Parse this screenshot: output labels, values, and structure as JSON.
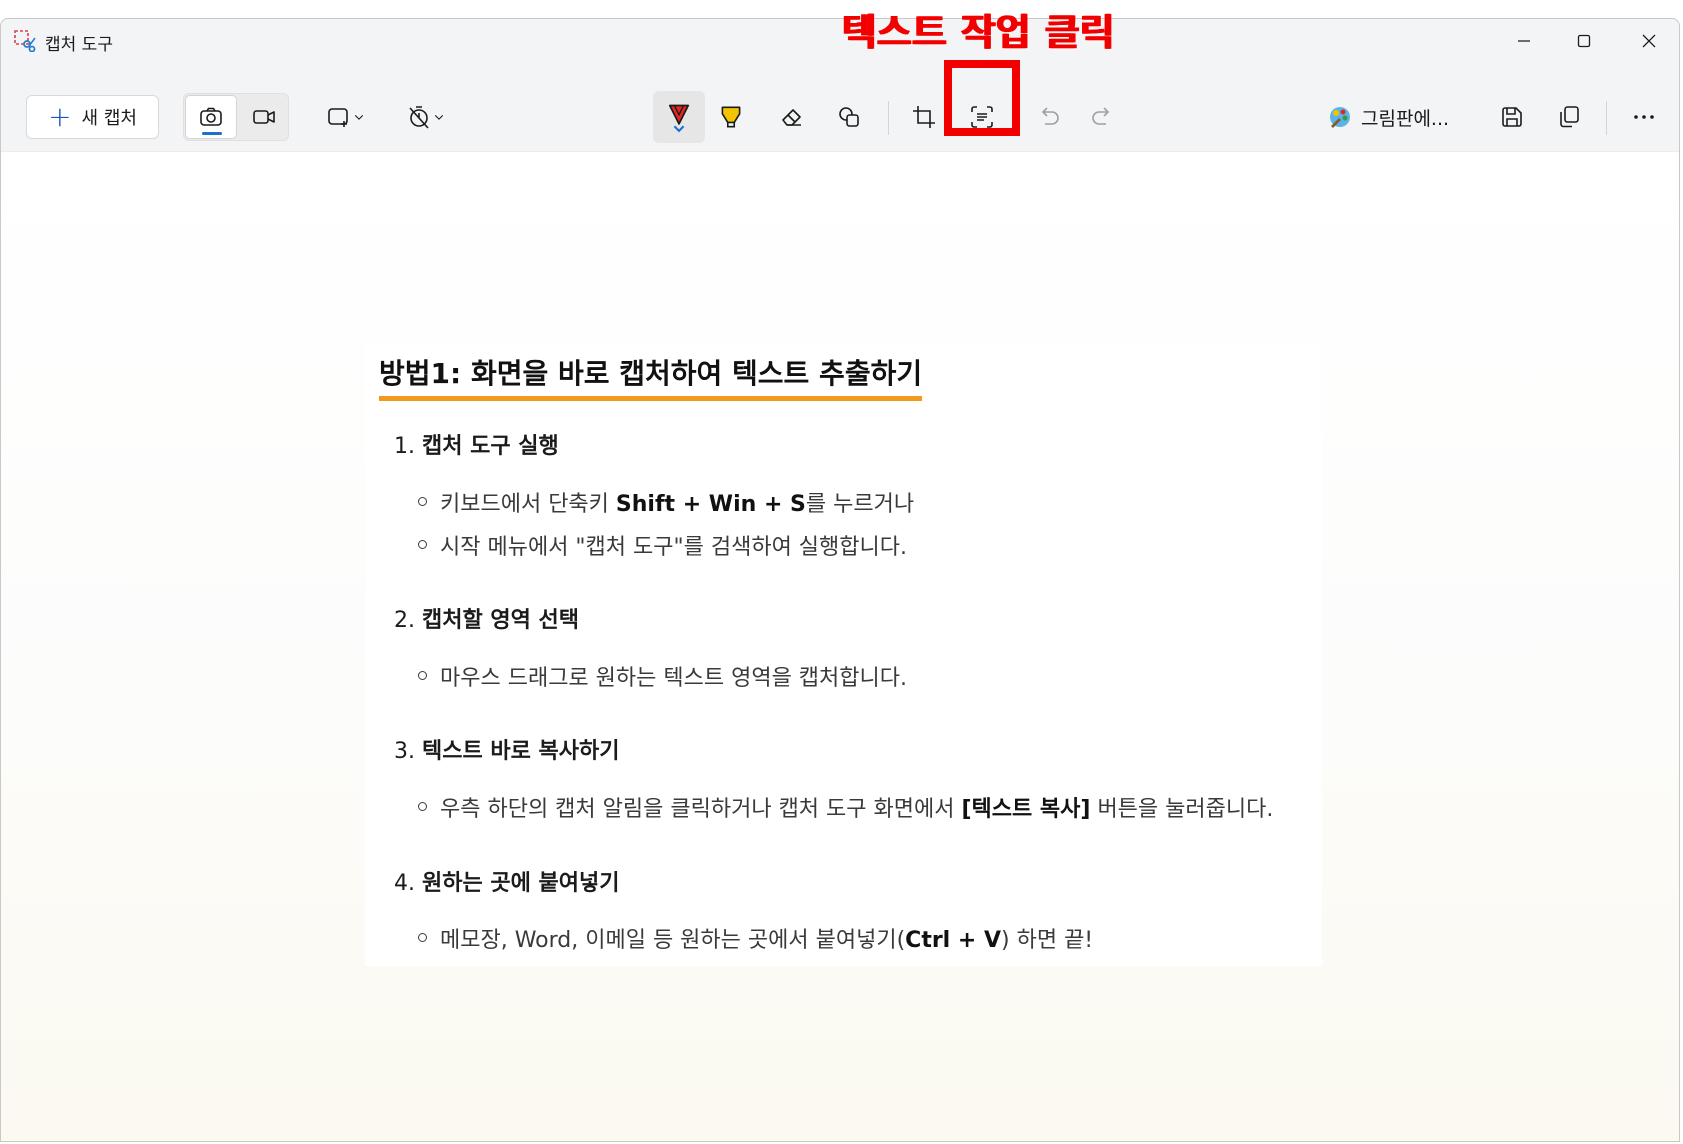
{
  "window": {
    "title": "캡처 도구"
  },
  "toolbar": {
    "new_capture_label": "새 캡처",
    "paint_label": "그림판에..."
  },
  "annotation": {
    "callout": "텍스트 작업 클릭",
    "color": "#f20000"
  },
  "document": {
    "title": "방법1: 화면을 바로 캡처하여 텍스트 추출하기",
    "steps": [
      {
        "num": "1.",
        "title": "캡처 도구 실행",
        "bullets": [
          {
            "parts": [
              "키보드에서 단축키 ",
              "Shift +  Win + S",
              "를 누르거나"
            ]
          },
          {
            "text": "시작 메뉴에서 \"캡처 도구\"를 검색하여 실행합니다."
          }
        ]
      },
      {
        "num": "2.",
        "title": "캡처할 영역 선택",
        "bullets": [
          {
            "text": "마우스 드래그로 원하는 텍스트 영역을 캡처합니다."
          }
        ]
      },
      {
        "num": "3.",
        "title": "텍스트 바로 복사하기",
        "bullets": [
          {
            "parts": [
              "우측 하단의 캡처 알림을 클릭하거나 캡처 도구 화면에서 ",
              "[텍스트 복사]",
              " 버튼을 눌러줍니다."
            ]
          }
        ]
      },
      {
        "num": "4.",
        "title": "원하는 곳에 붙여넣기",
        "bullets": [
          {
            "parts": [
              "메모장, Word, 이메일 등 원하는 곳에서 붙여넣기(",
              "Ctrl + V",
              ") 하면 끝!"
            ]
          }
        ]
      }
    ]
  },
  "colors": {
    "accent": "#1a6fd1",
    "highlight_underline": "#f29a1f",
    "pen_red": "#e52620",
    "highlighter_yellow": "#f5c400"
  }
}
